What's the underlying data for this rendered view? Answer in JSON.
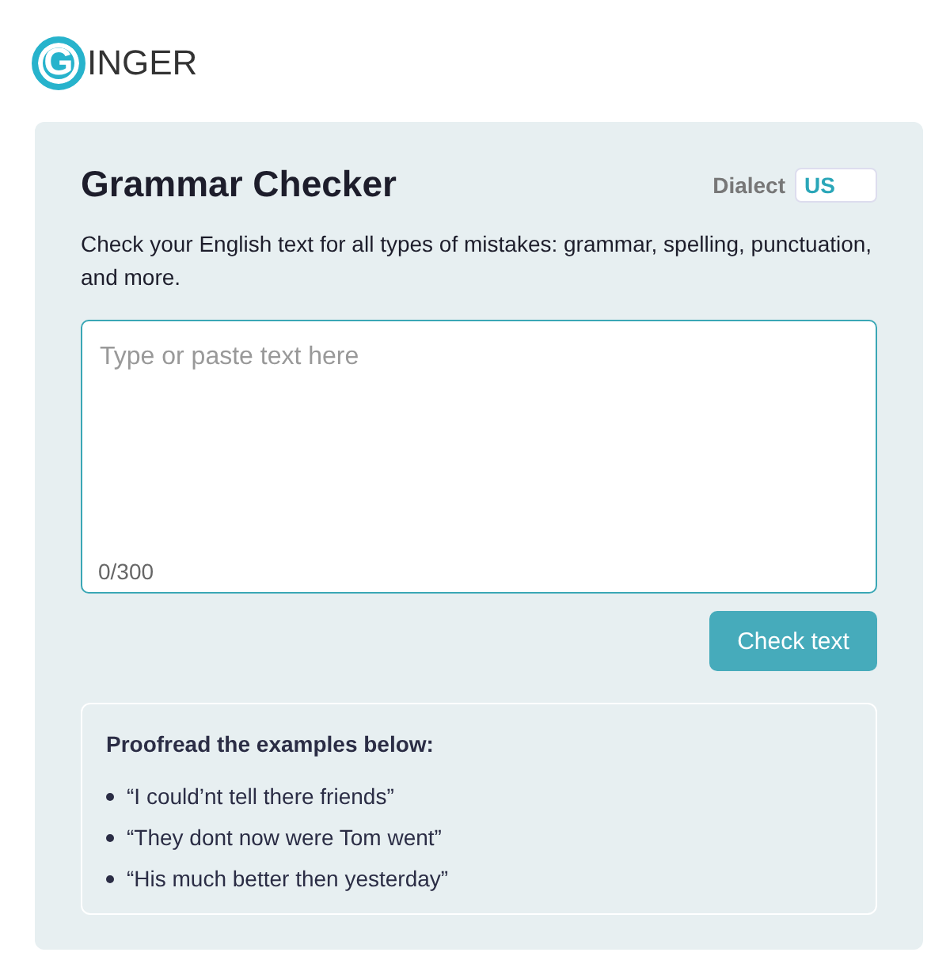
{
  "logo": {
    "initial": "G",
    "rest": "INGER"
  },
  "checker": {
    "title": "Grammar Checker",
    "dialect_label": "Dialect",
    "dialect_value": "US",
    "description": "Check your English text for all types of mistakes: grammar, spelling, punctuation, and more.",
    "text_field": {
      "placeholder": "Type or paste text here",
      "counter": "0/300"
    },
    "button": "Check text"
  },
  "examples": {
    "heading": "Proofread the examples below:",
    "items": [
      "“I could’nt tell there friends”",
      "“They dont now were Tom went”",
      "“His much better then yesterday”"
    ]
  }
}
